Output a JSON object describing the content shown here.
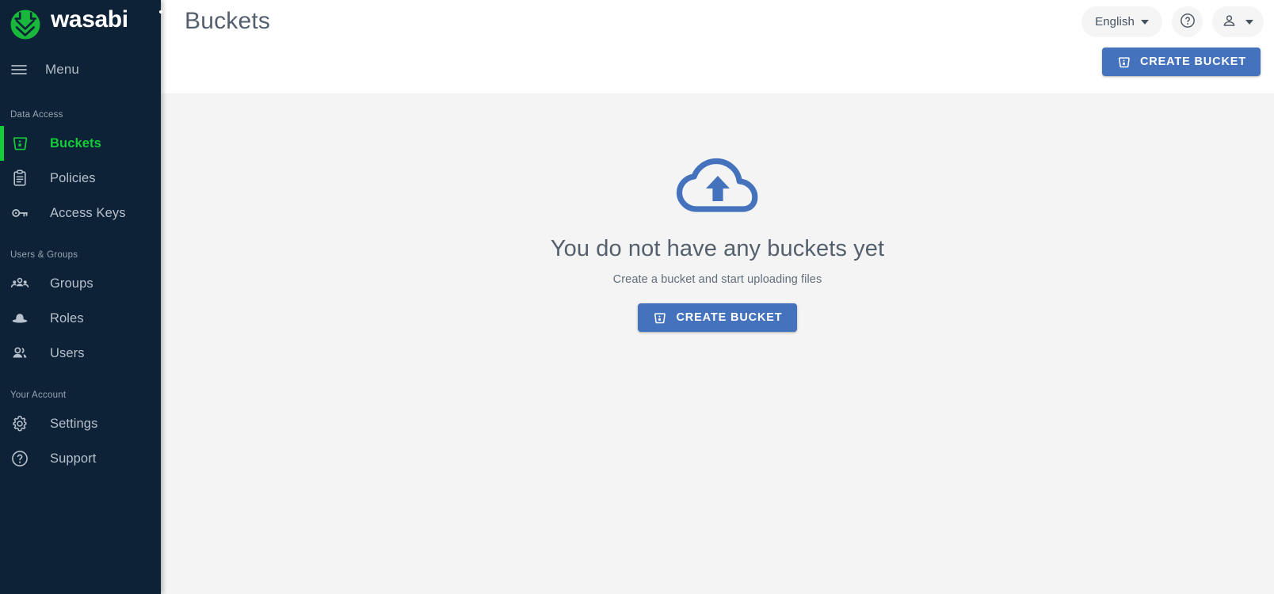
{
  "brand": {
    "name": "wasabi",
    "logo_icon": "wasabi-logo-icon"
  },
  "sidebar": {
    "menu_label": "Menu",
    "menu_icon": "hamburger-icon",
    "sections": [
      {
        "label": "Data Access",
        "items": [
          {
            "label": "Buckets",
            "icon": "bucket-icon",
            "active": true
          },
          {
            "label": "Policies",
            "icon": "clipboard-icon",
            "active": false
          },
          {
            "label": "Access Keys",
            "icon": "key-icon",
            "active": false
          }
        ]
      },
      {
        "label": "Users & Groups",
        "items": [
          {
            "label": "Groups",
            "icon": "group-people-icon",
            "active": false
          },
          {
            "label": "Roles",
            "icon": "hat-icon",
            "active": false
          },
          {
            "label": "Users",
            "icon": "person-pair-icon",
            "active": false
          }
        ]
      },
      {
        "label": "Your Account",
        "items": [
          {
            "label": "Settings",
            "icon": "gear-icon",
            "active": false
          },
          {
            "label": "Support",
            "icon": "question-mark-icon",
            "active": false
          }
        ]
      }
    ]
  },
  "header": {
    "title": "Buckets",
    "language": {
      "label": "English",
      "caret_icon": "chevron-down-icon"
    },
    "help_icon": "question-circle-icon",
    "account": {
      "avatar_icon": "person-icon",
      "caret_icon": "chevron-down-icon"
    },
    "create_bucket_label": "CREATE BUCKET",
    "create_bucket_icon": "bucket-icon"
  },
  "empty_state": {
    "illustration_icon": "cloud-upload-icon",
    "title": "You do not have any buckets yet",
    "subtitle": "Create a bucket and start uploading files",
    "cta_label": "CREATE BUCKET",
    "cta_icon": "bucket-icon"
  },
  "colors": {
    "sidebar_bg": "#0d2137",
    "accent_green": "#12cc3a",
    "primary_blue": "#4472bd",
    "content_bg": "#f4f4f4",
    "text_muted": "#54606e"
  }
}
